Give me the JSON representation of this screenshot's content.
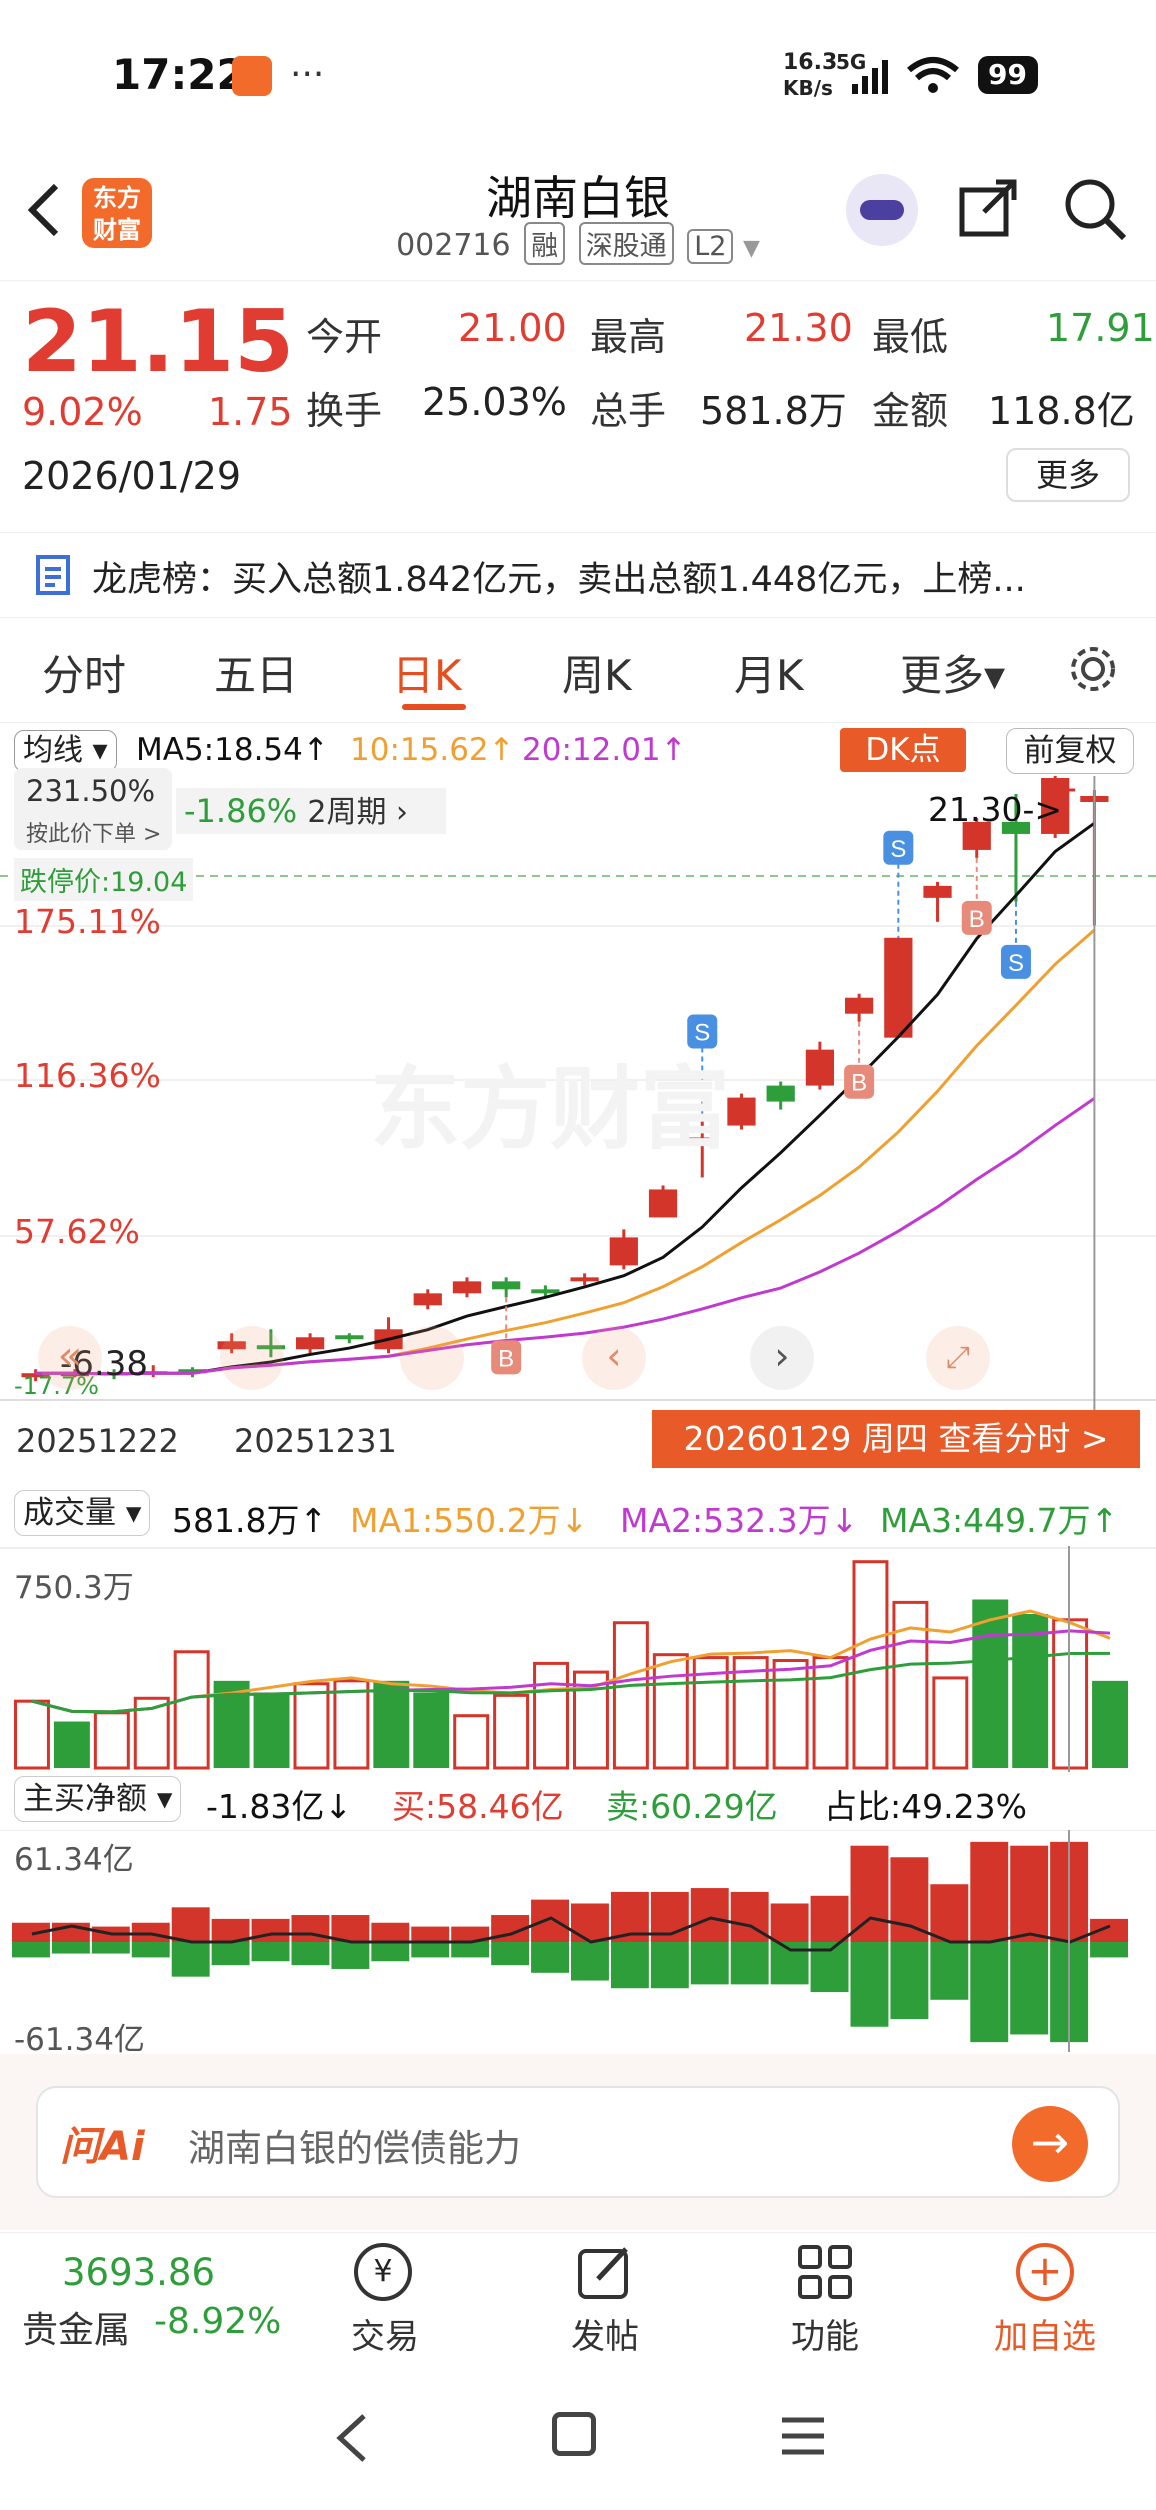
{
  "status_bar": {
    "time": "17:22",
    "dots": "···",
    "speed_value": "16.3",
    "speed_unit": "KB/s",
    "network": "5G",
    "battery": "99"
  },
  "header": {
    "back": "<",
    "logo_line1": "东方",
    "logo_line2": "财富",
    "title": "湖南白银",
    "code": "002716",
    "tags": [
      "融",
      "深股通",
      "L2"
    ]
  },
  "quote": {
    "price": "21.15",
    "change_pct": "9.02%",
    "change": "1.75",
    "date": "2026/01/29",
    "fields": [
      {
        "label": "今开",
        "value": "21.00",
        "color": "red"
      },
      {
        "label": "最高",
        "value": "21.30",
        "color": "red"
      },
      {
        "label": "最低",
        "value": "17.91",
        "color": "green"
      },
      {
        "label": "换手",
        "value": "25.03%",
        "color": "dark"
      },
      {
        "label": "总手",
        "value": "581.8万",
        "color": "dark"
      },
      {
        "label": "金额",
        "value": "118.8亿",
        "color": "dark"
      }
    ],
    "more_button": "更多"
  },
  "dragon_tiger": {
    "text": "龙虎榜：买入总额1.842亿元，卖出总额1.448亿元，上榜..."
  },
  "tabs": [
    "分时",
    "五日",
    "日K",
    "周K",
    "月K",
    "更多▾"
  ],
  "active_tab": "日K",
  "kline_legend": {
    "mode": "均线",
    "ma5": "MA5:18.54↑",
    "ma10": "10:15.62↑",
    "ma20": "20:12.01↑",
    "dk_button": "DK点",
    "adjust_button": "前复权"
  },
  "kline_overlay": {
    "top_pct": "231.50%",
    "hint": "按此价下单 >",
    "period_change": "-1.86%",
    "period_label": "2周期 ›",
    "high_marker": "21.30->",
    "limit_down_label": "跌停价:19.04",
    "levels": [
      "175.11%",
      "116.36%",
      "57.62%"
    ],
    "low_value": "-6.38",
    "low_pct": "-17.7%",
    "date_left": "20251222",
    "date_mid": "20251231",
    "date_pill": "20260129 周四 查看分时 >",
    "watermark": "东方财富"
  },
  "chart_data": [
    {
      "type": "candlestick",
      "title": "",
      "dates": [
        "20251222",
        "20251231",
        "20260129"
      ],
      "candles": [
        {
          "o": 6.6,
          "c": 6.7,
          "h": 6.8,
          "l": 6.5
        },
        {
          "o": 6.65,
          "c": 6.7,
          "h": 6.8,
          "l": 6.6
        },
        {
          "o": 6.72,
          "c": 6.65,
          "h": 6.8,
          "l": 6.55
        },
        {
          "o": 6.7,
          "c": 6.75,
          "h": 6.9,
          "l": 6.6
        },
        {
          "o": 6.8,
          "c": 6.7,
          "h": 6.85,
          "l": 6.6
        },
        {
          "o": 7.3,
          "c": 7.5,
          "h": 7.7,
          "l": 7.2
        },
        {
          "o": 7.4,
          "c": 7.3,
          "h": 7.8,
          "l": 7.1
        },
        {
          "o": 7.3,
          "c": 7.6,
          "h": 7.7,
          "l": 7.2
        },
        {
          "o": 7.65,
          "c": 7.55,
          "h": 7.7,
          "l": 7.45
        },
        {
          "o": 7.3,
          "c": 7.8,
          "h": 8.1,
          "l": 7.2
        },
        {
          "o": 8.4,
          "c": 8.7,
          "h": 8.8,
          "l": 8.3
        },
        {
          "o": 8.7,
          "c": 9.0,
          "h": 9.1,
          "l": 8.6
        },
        {
          "o": 9.0,
          "c": 8.8,
          "h": 9.1,
          "l": 8.6
        },
        {
          "o": 8.8,
          "c": 8.7,
          "h": 8.9,
          "l": 8.6
        },
        {
          "o": 9.0,
          "c": 9.1,
          "h": 9.2,
          "l": 8.9
        },
        {
          "o": 9.4,
          "c": 10.1,
          "h": 10.3,
          "l": 9.3
        },
        {
          "o": 10.6,
          "c": 11.3,
          "h": 11.4,
          "l": 10.6
        },
        {
          "o": 12.4,
          "c": 12.6,
          "h": 13.0,
          "l": 11.6
        },
        {
          "o": 12.9,
          "c": 13.6,
          "h": 13.7,
          "l": 12.8
        },
        {
          "o": 13.9,
          "c": 13.5,
          "h": 14.0,
          "l": 13.3
        },
        {
          "o": 13.9,
          "c": 14.8,
          "h": 15.0,
          "l": 13.8
        },
        {
          "o": 15.7,
          "c": 16.1,
          "h": 16.2,
          "l": 15.5
        },
        {
          "o": 15.1,
          "c": 17.6,
          "h": 17.6,
          "l": 15.1
        },
        {
          "o": 18.6,
          "c": 18.9,
          "h": 19.0,
          "l": 18.0
        },
        {
          "o": 19.8,
          "c": 20.5,
          "h": 20.6,
          "l": 19.6
        },
        {
          "o": 20.5,
          "c": 20.2,
          "h": 21.2,
          "l": 18.5
        },
        {
          "o": 20.2,
          "c": 21.6,
          "h": 21.7,
          "l": 20.1
        },
        {
          "o": 21.0,
          "c": 21.15,
          "h": 21.3,
          "l": 17.91
        }
      ]
    },
    {
      "type": "bar",
      "title": "成交量",
      "legend": [
        "581.8万↑",
        "MA1:550.2万↓",
        "MA2:532.3万↓",
        "MA3:449.7万↑"
      ],
      "ymax_label": "750.3万",
      "values": [
        230,
        160,
        190,
        240,
        400,
        300,
        260,
        290,
        300,
        300,
        260,
        180,
        250,
        360,
        330,
        500,
        390,
        380,
        380,
        370,
        380,
        710,
        570,
        310,
        580,
        530,
        510,
        300
      ],
      "colors": [
        "red",
        "green",
        "red",
        "red",
        "red",
        "green",
        "green",
        "red",
        "red",
        "green",
        "green",
        "red",
        "red",
        "red",
        "red",
        "red",
        "red",
        "red",
        "red",
        "red",
        "red",
        "red",
        "red",
        "red",
        "green",
        "green",
        "red",
        "green"
      ]
    },
    {
      "type": "bar",
      "title": "主买净额",
      "legend": [
        "-1.83亿↓",
        "买:58.46亿",
        "卖:60.29亿",
        "占比:49.23%"
      ],
      "ymax_label": "61.34亿",
      "ymin_label": "-61.34亿",
      "buy": [
        10,
        10,
        8,
        10,
        18,
        12,
        12,
        14,
        14,
        10,
        8,
        8,
        14,
        22,
        20,
        26,
        26,
        28,
        26,
        20,
        24,
        50,
        44,
        30,
        52,
        50,
        52,
        12
      ],
      "sell": [
        -8,
        -6,
        -6,
        -8,
        -18,
        -12,
        -10,
        -12,
        -14,
        -10,
        -8,
        -8,
        -12,
        -16,
        -20,
        -24,
        -24,
        -22,
        -22,
        -22,
        -26,
        -44,
        -40,
        -30,
        -52,
        -48,
        -52,
        -8
      ]
    }
  ],
  "ai_bar": {
    "brand": "问Ai",
    "placeholder": "湖南白银的偿债能力"
  },
  "bottom_nav": {
    "index_value": "3693.86",
    "index_name": "贵金属",
    "index_change": "-8.92%",
    "items": [
      "交易",
      "发帖",
      "功能",
      "加自选"
    ]
  }
}
